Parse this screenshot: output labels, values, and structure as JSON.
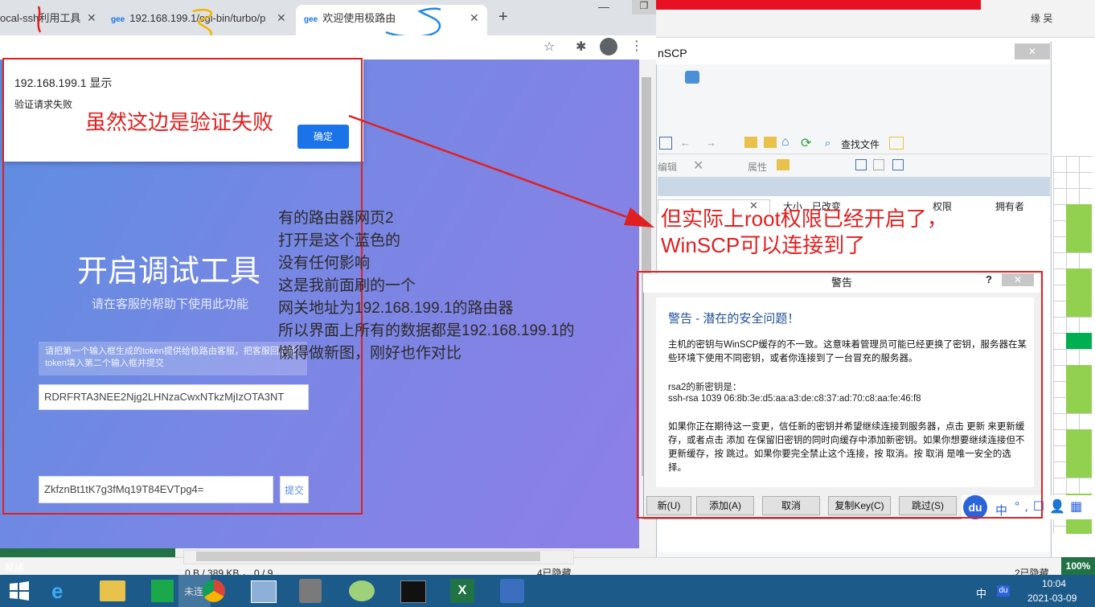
{
  "browser": {
    "tabs": [
      {
        "label": "ocal-ssh利用工具"
      },
      {
        "label": "192.168.199.1/cgi-bin/turbo/p"
      },
      {
        "label": "欢迎使用极路由"
      }
    ],
    "favicon_text": "gee",
    "close_glyph": "✕",
    "new_tab_glyph": "+",
    "win_min_glyph": "—",
    "win_max_glyph": "❐"
  },
  "dialog": {
    "host_line": "192.168.199.1 显示",
    "message": "验证请求失败",
    "ok_label": "确定"
  },
  "page": {
    "title": "开启调试工具",
    "subtitle": "请在客服的帮助下使用此功能",
    "hint": "请把第一个输入框生成的token提供给极路由客服，把客服回执的token填入第二个输入框并提交",
    "token_value": "RDRFRTA3NEE2Njg2LHNzaCwxNTkzMjIzOTA3NT",
    "answer_value": "ZkfznBt1tK7g3fMq19T84EVTpg4=",
    "submit_label": "提交"
  },
  "annotations": {
    "left_red": "虽然这边是验证失败",
    "note_lines": [
      "有的路由器网页2",
      "打开是这个蓝色的",
      "没有任何影响",
      "这是我前面刷的一个",
      "网关地址为192.168.199.1的路由器",
      "所以界面上所有的数据都是192.168.199.1的",
      "懒得做新图，刚好也作对比"
    ],
    "right_red_line1": "但实际上root权限已经开启了，",
    "right_red_line2": "WinSCP可以连接到了"
  },
  "winscp": {
    "title": "nSCP",
    "find_files": "查找文件",
    "edit": "编辑",
    "properties": "属性",
    "columns": [
      "大小",
      "已改变",
      "权限",
      "拥有者"
    ],
    "status": "0 B / 389 KB ，  0 / 9",
    "hidden_left": "4已隐藏",
    "hidden_right": "2已隐藏"
  },
  "warning": {
    "title": "警告",
    "help": "?",
    "heading": "警告 - 潜在的安全问题！",
    "para1": "主机的密钥与WinSCP缓存的不一致。这意味着管理员可能已经更换了密钥，服务器在某些环境下使用不同密钥，或者你连接到了一台冒充的服务器。",
    "key_header": "rsa2的新密钥是：",
    "key": "ssh-rsa 1039 06:8b:3e:d5:aa:a3:de:c8:37:ad:70:c8:aa:fe:46:f8",
    "para2": "如果你正在期待这一变更，信任新的密钥并希望继续连接到服务器，点击 更新 来更新缓存，或者点击 添加 在保留旧密钥的同时向缓存中添加新密钥。如果你想要继续连接但不更新缓存，按 跳过。如果你要完全禁止这个连接，按 取消。按 取消 是唯一安全的选择。",
    "buttons": {
      "update": "新(U)",
      "add": "添加(A)",
      "cancel": "取消",
      "copy_key": "复制Key(C)",
      "skip": "跳过(S)"
    }
  },
  "excel": {
    "user": "缘 吴",
    "status_ready": "就绪",
    "zoom": "100%"
  },
  "ime": {
    "logo": "du",
    "lang": "中",
    "symbols": "°,☐👤▦"
  },
  "taskbar": {
    "unnamed_label": "未连",
    "tray_lang": "中",
    "tray_du": "du",
    "time": "10:04",
    "date": "2021-03-09"
  },
  "colors": {
    "annotation_red": "#e02020",
    "gradient_start": "#5c8ee0",
    "gradient_end": "#8d7fe6",
    "chrome_blue": "#1a73e8",
    "excel_green": "#217346",
    "taskbar": "#1c5a8a"
  }
}
